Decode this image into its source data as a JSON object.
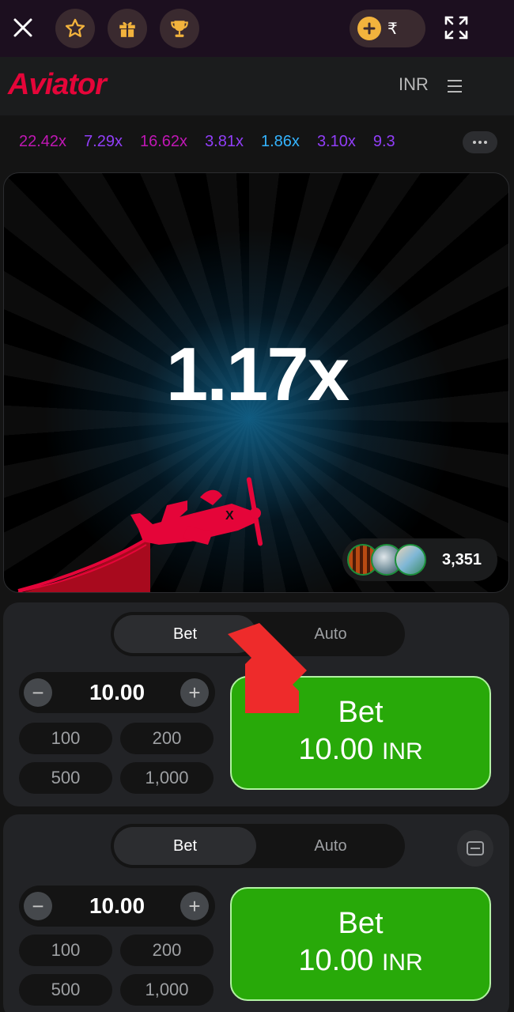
{
  "topbar": {
    "close_icon": "close-icon",
    "favorites_icon": "star-icon",
    "gift_icon": "gift-icon",
    "trophy_icon": "trophy-icon",
    "balance_currency_symbol": "₹",
    "fullscreen_icon": "fullscreen-icon"
  },
  "header": {
    "logo": "Aviator",
    "currency": "INR",
    "menu_icon": "hamburger-menu-icon"
  },
  "history": {
    "items": [
      {
        "value": "22.42x",
        "color": "#c017b4"
      },
      {
        "value": "7.29x",
        "color": "#913ef8"
      },
      {
        "value": "16.62x",
        "color": "#c017b4"
      },
      {
        "value": "3.81x",
        "color": "#913ef8"
      },
      {
        "value": "1.86x",
        "color": "#34b4ff"
      },
      {
        "value": "3.10x",
        "color": "#913ef8"
      },
      {
        "value": "9.3",
        "color": "#913ef8"
      }
    ],
    "more_icon": "ellipsis-icon"
  },
  "game": {
    "multiplier": "1.17x",
    "players_count": "3,351"
  },
  "bet_panels": [
    {
      "tabs": [
        "Bet",
        "Auto"
      ],
      "amount": "10.00",
      "quick_amounts": [
        "100",
        "200",
        "500",
        "1,000"
      ],
      "button_line1": "Bet",
      "button_amount": "10.00",
      "button_currency": "INR"
    },
    {
      "tabs": [
        "Bet",
        "Auto"
      ],
      "amount": "10.00",
      "quick_amounts": [
        "100",
        "200",
        "500",
        "1,000"
      ],
      "button_line1": "Bet",
      "button_amount": "10.00",
      "button_currency": "INR"
    }
  ],
  "colors": {
    "brand_red": "#e50539",
    "bet_green": "#28a909",
    "arrow_red": "#ee2b2b"
  }
}
